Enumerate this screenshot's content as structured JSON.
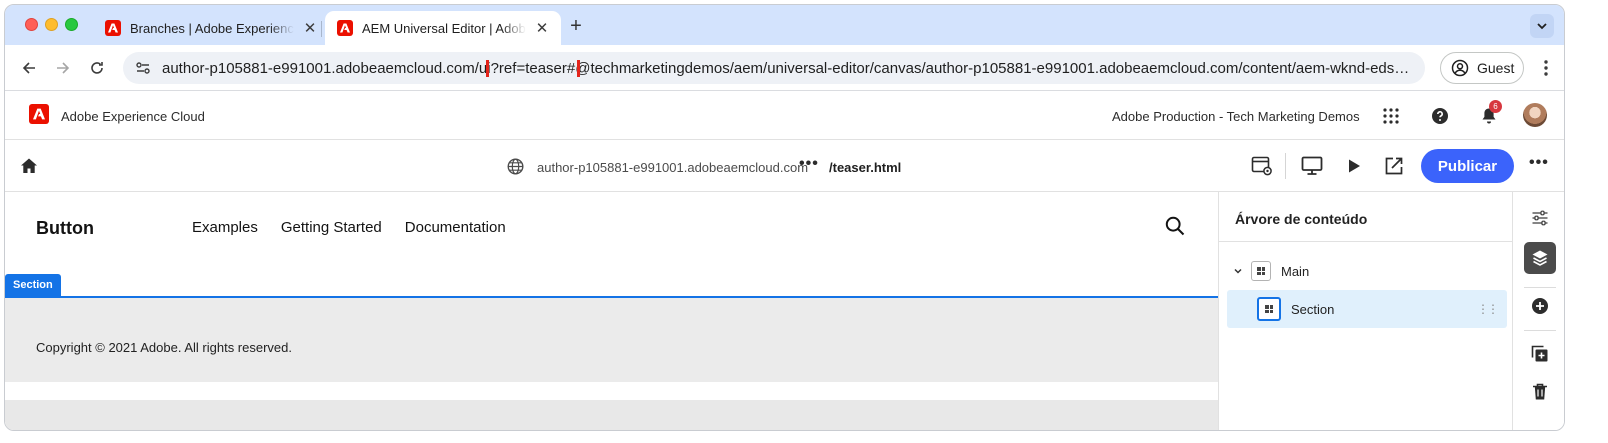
{
  "browser": {
    "tabs": [
      {
        "title": "Branches | Adobe Experience",
        "close": "✕"
      },
      {
        "title": "AEM Universal Editor | Adobe",
        "close": "✕"
      }
    ],
    "new_tab": "+",
    "url_prefix": "author-p105881-e991001.adobeaemcloud.com/ui",
    "url_highlight": "?ref=teaser#",
    "url_suffix": "@techmarketingdemos/aem/universal-editor/canvas/author-p105881-e991001.adobeaemcloud.com/content/aem-wknd-eds-ue/b...",
    "guest_label": "Guest"
  },
  "shell": {
    "title": "Adobe Experience Cloud",
    "org": "Adobe Production - Tech Marketing Demos",
    "notification_count": "6"
  },
  "editor": {
    "host": "author-p105881-e991001.adobeaemcloud.com",
    "path_dots": "•••",
    "path": "/teaser.html",
    "publish_label": "Publicar",
    "more": "•••"
  },
  "canvas": {
    "brand": "Button",
    "nav": [
      "Examples",
      "Getting Started",
      "Documentation"
    ],
    "section_tag": "Section",
    "copyright": "Copyright © 2021 Adobe. All rights reserved."
  },
  "tree": {
    "title": "Árvore de conteúdo",
    "items": [
      {
        "label": "Main"
      },
      {
        "label": "Section"
      }
    ]
  },
  "colors": {
    "accent": "#3b63fb",
    "selection": "#1473e6",
    "adobe_red": "#eb1000",
    "highlight_box": "#e3241b"
  }
}
